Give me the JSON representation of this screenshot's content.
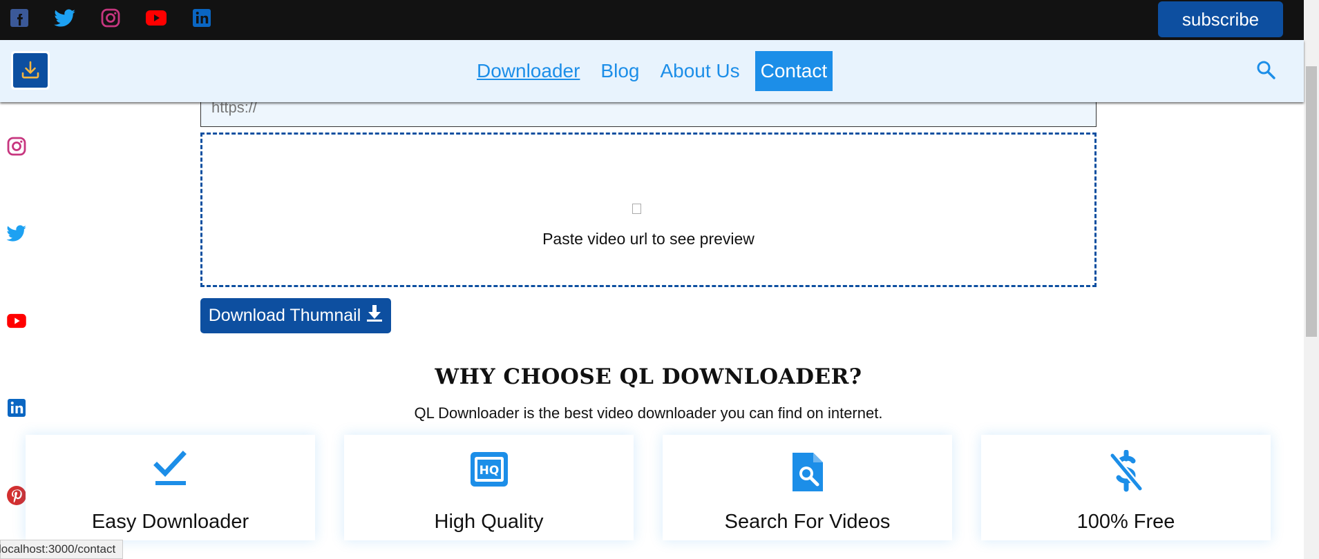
{
  "topbar": {
    "social_icons": [
      "facebook-icon",
      "twitter-icon",
      "instagram-icon",
      "youtube-icon",
      "linkedin-icon"
    ],
    "subscribe_label": "subscribe"
  },
  "nav": {
    "links": [
      "Downloader",
      "Blog",
      "About Us",
      "Contact"
    ],
    "active": "Downloader",
    "highlighted": "Contact"
  },
  "side_social": [
    "instagram-icon",
    "twitter-icon",
    "youtube-icon",
    "linkedin-icon",
    "pinterest-icon"
  ],
  "url_input": {
    "placeholder": "https://"
  },
  "preview": {
    "message": "Paste video url to see preview"
  },
  "download_button": {
    "label": "Download Thumnail"
  },
  "why": {
    "title": "WHY CHOOSE QL DOWNLOADER?",
    "subtitle": "QL Downloader is the best video downloader you can find on internet."
  },
  "features": [
    {
      "label": "Easy Downloader",
      "icon": "download-check-icon"
    },
    {
      "label": "High Quality",
      "icon": "hq-icon"
    },
    {
      "label": "Search For Videos",
      "icon": "file-search-icon"
    },
    {
      "label": "100% Free",
      "icon": "no-dollar-icon"
    }
  ],
  "status_bar": {
    "url": "localhost:3000/contact"
  },
  "colors": {
    "brand": "#0d4fa0",
    "accent": "#1c8ee8",
    "topbar": "#121212",
    "nav_bg": "#e8f3fd"
  }
}
